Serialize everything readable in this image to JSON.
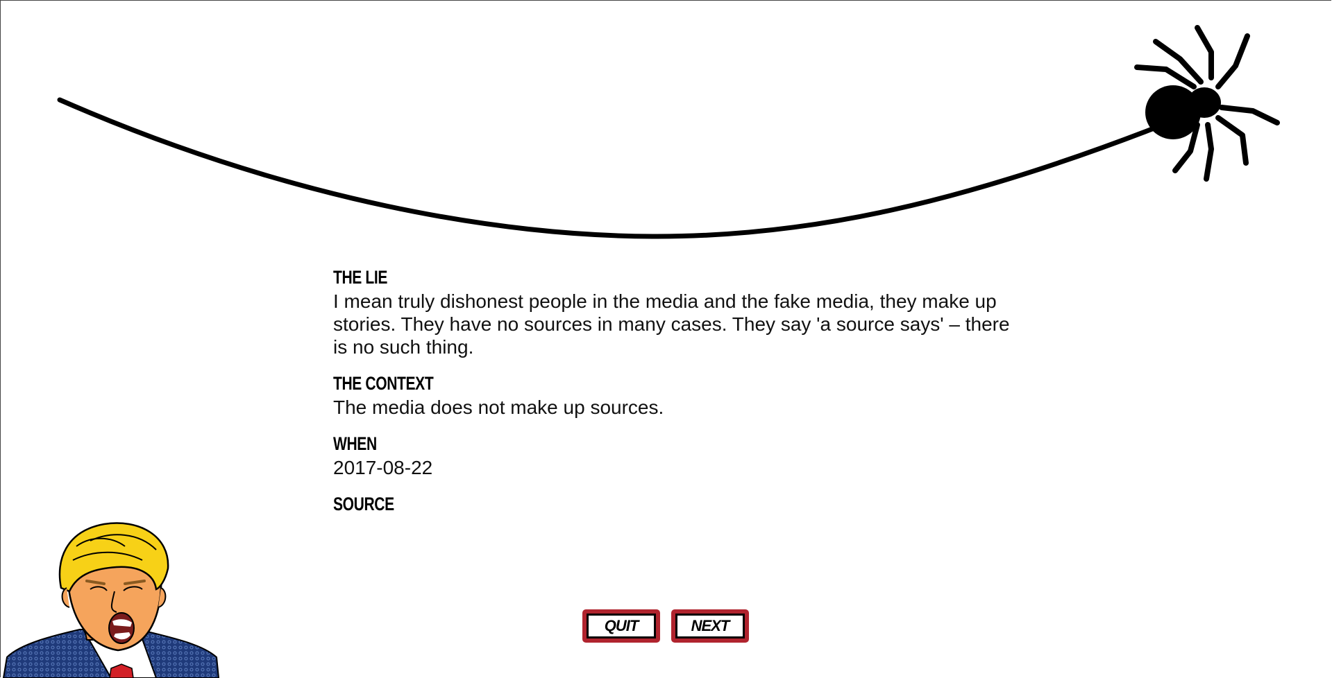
{
  "sections": {
    "lie": {
      "heading": "THE LIE",
      "text": "I mean truly dishonest people in the media and the fake media, they make up stories. They have no sources in many cases. They say 'a source says' – there is no such thing."
    },
    "context": {
      "heading": "THE CONTEXT",
      "text": "The media does not make up sources."
    },
    "when": {
      "heading": "WHEN",
      "text": "2017-08-22"
    },
    "source": {
      "heading": "SOURCE",
      "text": ""
    }
  },
  "buttons": {
    "quit_label": "QUIT",
    "next_label": "NEXT"
  },
  "colors": {
    "button_border": "#b0242e",
    "web_line": "#000000",
    "hair": "#f7d117",
    "skin": "#f5a45c",
    "suit": "#1f3a7a",
    "tie": "#d32027"
  },
  "icons": {
    "spider": "spider-icon",
    "character": "cartoon-politician-illustration"
  }
}
